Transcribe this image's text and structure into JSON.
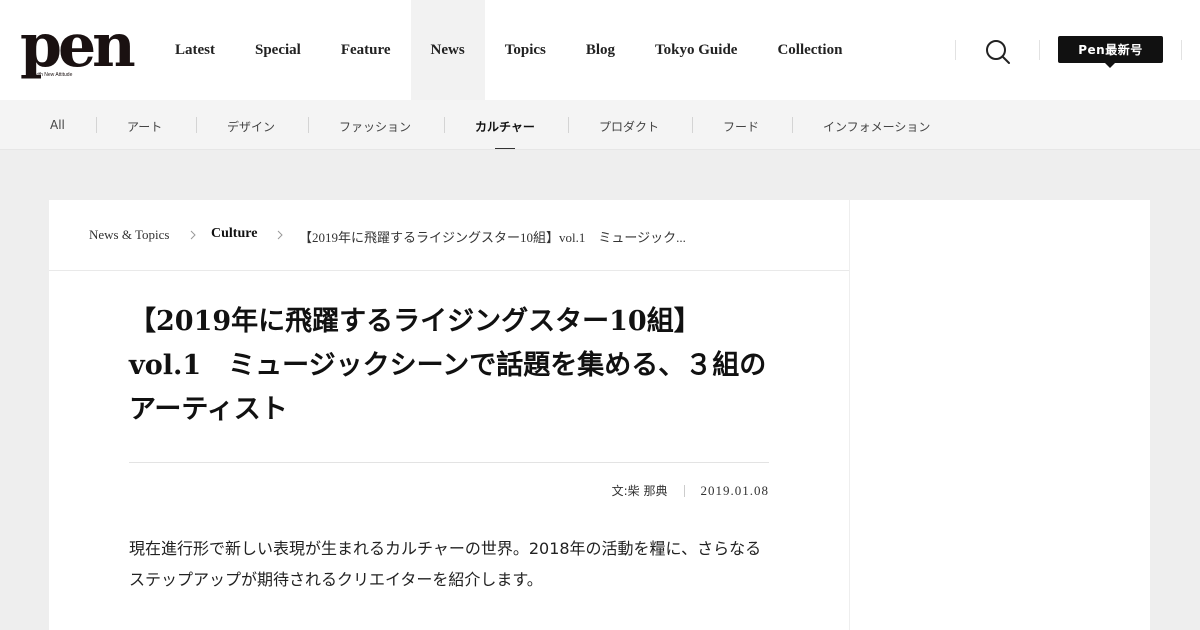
{
  "brand": {
    "logo": "pen",
    "tagline": "with New Attitude"
  },
  "nav": {
    "items": [
      {
        "label": "Latest"
      },
      {
        "label": "Special"
      },
      {
        "label": "Feature"
      },
      {
        "label": "News"
      },
      {
        "label": "Topics"
      },
      {
        "label": "Blog"
      },
      {
        "label": "Tokyo Guide"
      },
      {
        "label": "Collection"
      }
    ],
    "active": "News",
    "search_icon": "search-icon",
    "latest_issue_label": "Pen最新号"
  },
  "subnav": {
    "items": [
      {
        "label": "All"
      },
      {
        "label": "アート"
      },
      {
        "label": "デザイン"
      },
      {
        "label": "ファッション"
      },
      {
        "label": "カルチャー"
      },
      {
        "label": "プロダクト"
      },
      {
        "label": "フード"
      },
      {
        "label": "インフォメーション"
      }
    ],
    "active": "カルチャー"
  },
  "breadcrumb": {
    "items": [
      {
        "label": "News & Topics"
      },
      {
        "label": "Culture"
      },
      {
        "label": "【2019年に飛躍するライジングスター10組】vol.1　ミュージック..."
      }
    ]
  },
  "article": {
    "title": "【2019年に飛躍するライジングスター10組】vol.1　ミュージックシーンで話題を集める、３組のアーティスト",
    "author": "文:柴 那典",
    "date": "2019.01.08",
    "lead": "現在進行形で新しい表現が生まれるカルチャーの世界。2018年の活動を糧に、さらなるステップアップが期待されるクリエイターを紹介します。"
  },
  "colors": {
    "page_bg": "#eeeeee",
    "header_bg": "#ffffff",
    "subnav_bg": "#f4f4f4",
    "active_nav_bg": "#f2f2f2",
    "button_bg": "#111111",
    "text": "#222222"
  }
}
